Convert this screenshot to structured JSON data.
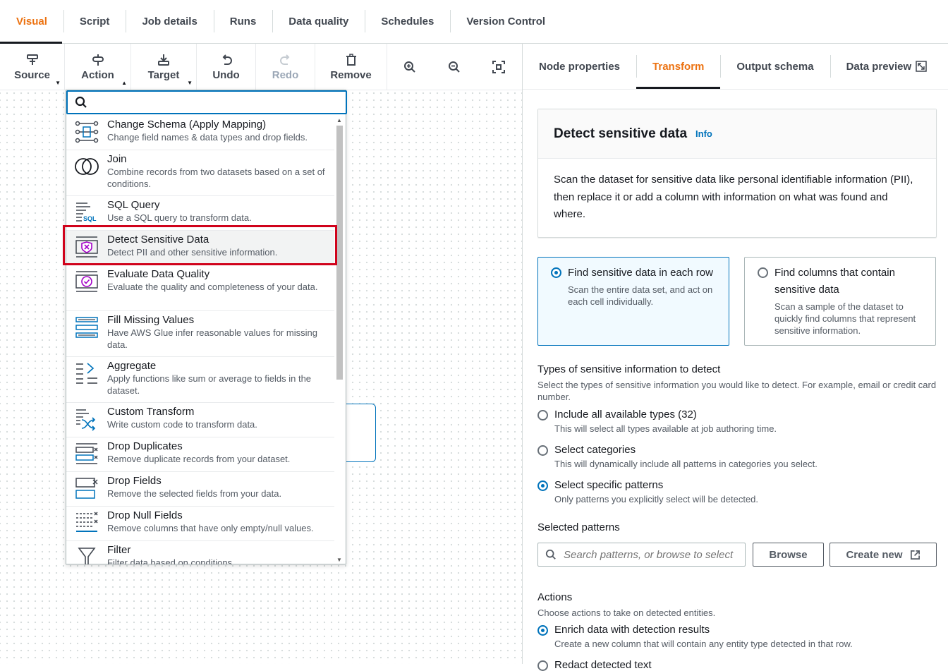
{
  "top_tabs": [
    "Visual",
    "Script",
    "Job details",
    "Runs",
    "Data quality",
    "Schedules",
    "Version Control"
  ],
  "toolbar": {
    "source": "Source",
    "action": "Action",
    "target": "Target",
    "undo": "Undo",
    "redo": "Redo",
    "remove": "Remove"
  },
  "dropdown": {
    "search_placeholder": "",
    "items": [
      {
        "title": "Change Schema (Apply Mapping)",
        "desc": "Change field names & data types and drop fields."
      },
      {
        "title": "Join",
        "desc": "Combine records from two datasets based on a set of conditions."
      },
      {
        "title": "SQL Query",
        "desc": "Use a SQL query to transform data."
      },
      {
        "title": "Detect Sensitive Data",
        "desc": "Detect PII and other sensitive information."
      },
      {
        "title": "Evaluate Data Quality",
        "desc": "Evaluate the quality and completeness of your data."
      },
      {
        "title": "Fill Missing Values",
        "desc": "Have AWS Glue infer reasonable values for missing data."
      },
      {
        "title": "Aggregate",
        "desc": "Apply functions like sum or average to fields in the dataset."
      },
      {
        "title": "Custom Transform",
        "desc": "Write custom code to transform data."
      },
      {
        "title": "Drop Duplicates",
        "desc": "Remove duplicate records from your dataset."
      },
      {
        "title": "Drop Fields",
        "desc": "Remove the selected fields from your data."
      },
      {
        "title": "Drop Null Fields",
        "desc": "Remove columns that have only empty/null values."
      },
      {
        "title": "Filter",
        "desc": "Filter data based on conditions."
      }
    ]
  },
  "right_tabs": [
    "Node properties",
    "Transform",
    "Output schema",
    "Data preview"
  ],
  "panel": {
    "title": "Detect sensitive data",
    "info": "Info",
    "description": "Scan the dataset for sensitive data like personal identifiable information (PII), then replace it or add a column with information on what was found and where.",
    "tile1_title": "Find sensitive data in each row",
    "tile1_desc": "Scan the entire data set, and act on each cell individually.",
    "tile2_title": "Find columns that contain sensitive data",
    "tile2_desc": "Scan a sample of the dataset to quickly find columns that represent sensitive information.",
    "types_label": "Types of sensitive information to detect",
    "types_desc": "Select the types of sensitive information you would like to detect. For example, email or credit card number.",
    "opt1_title": "Include all available types (32)",
    "opt1_desc": "This will select all types available at job authoring time.",
    "opt2_title": "Select categories",
    "opt2_desc": "This will dynamically include all patterns in categories you select.",
    "opt3_title": "Select specific patterns",
    "opt3_desc": "Only patterns you explicitly select will be detected.",
    "selected_patterns_label": "Selected patterns",
    "search_placeholder": "Search patterns, or browse to select",
    "browse": "Browse",
    "create_new": "Create new",
    "actions_label": "Actions",
    "actions_desc": "Choose actions to take on detected entities.",
    "act1_title": "Enrich data with detection results",
    "act1_desc": "Create a new column that will contain any entity type detected in that row.",
    "act2_title": "Redact detected text"
  },
  "colors": {
    "accent": "#ec7211",
    "link": "#0073bb",
    "highlight": "#d0021b"
  }
}
